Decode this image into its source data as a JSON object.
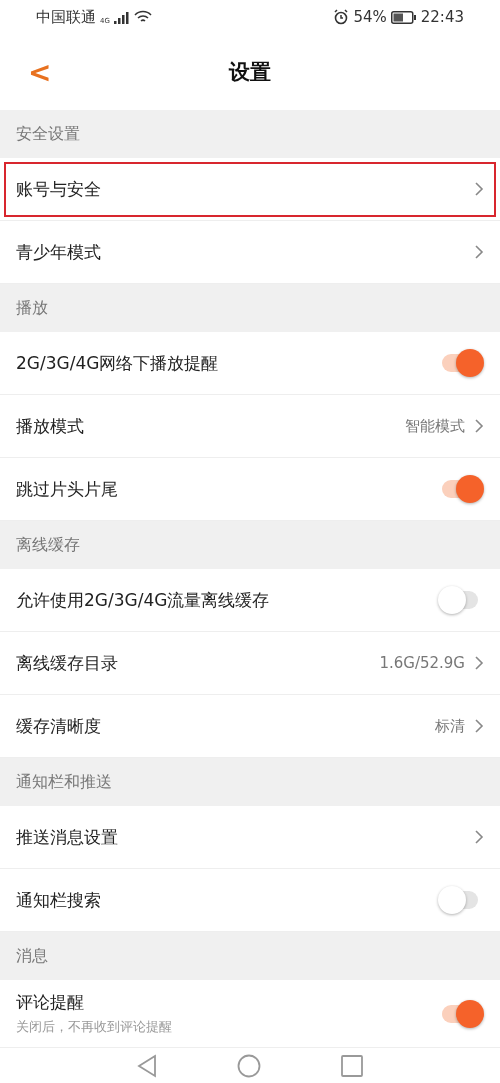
{
  "status_bar": {
    "carrier": "中国联通",
    "network": "4G",
    "battery": "54%",
    "time": "22:43"
  },
  "header": {
    "back": "<",
    "title": "设置"
  },
  "sections": [
    {
      "title": "安全设置",
      "items": [
        {
          "kind": "link",
          "label": "账号与安全",
          "highlighted": true
        },
        {
          "kind": "link",
          "label": "青少年模式",
          "highlighted": false
        }
      ]
    },
    {
      "title": "播放",
      "items": [
        {
          "kind": "toggle",
          "label": "2G/3G/4G网络下播放提醒",
          "on": true
        },
        {
          "kind": "link",
          "label": "播放模式",
          "value": "智能模式",
          "highlighted": false
        },
        {
          "kind": "toggle",
          "label": "跳过片头片尾",
          "on": true
        }
      ]
    },
    {
      "title": "离线缓存",
      "items": [
        {
          "kind": "toggle",
          "label": "允许使用2G/3G/4G流量离线缓存",
          "on": false
        },
        {
          "kind": "link",
          "label": "离线缓存目录",
          "value": "1.6G/52.9G",
          "highlighted": false
        },
        {
          "kind": "link",
          "label": "缓存清晰度",
          "value": "标清",
          "highlighted": false
        }
      ]
    },
    {
      "title": "通知栏和推送",
      "items": [
        {
          "kind": "link",
          "label": "推送消息设置",
          "highlighted": false
        },
        {
          "kind": "toggle",
          "label": "通知栏搜索",
          "on": false
        }
      ]
    },
    {
      "title": "消息",
      "items": [
        {
          "kind": "toggle",
          "label": "评论提醒",
          "subtitle": "关闭后，不再收到评论提醒",
          "on": true
        }
      ]
    }
  ]
}
